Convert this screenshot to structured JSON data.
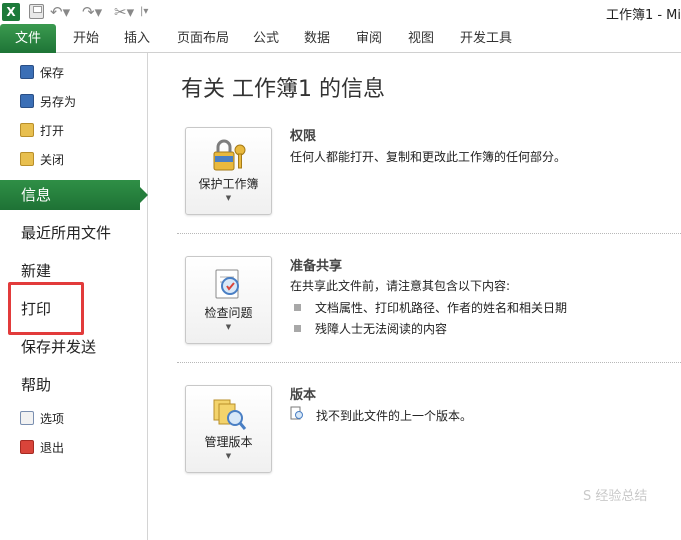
{
  "window": {
    "title": "工作簿1 - Mi"
  },
  "ribbon": {
    "tabs": [
      "文件",
      "开始",
      "插入",
      "页面布局",
      "公式",
      "数据",
      "审阅",
      "视图",
      "开发工具"
    ]
  },
  "nav": {
    "small_top": [
      {
        "label": "保存",
        "icon": "save-icon"
      },
      {
        "label": "另存为",
        "icon": "save-as-icon"
      },
      {
        "label": "打开",
        "icon": "open-folder-icon"
      },
      {
        "label": "关闭",
        "icon": "close-folder-icon"
      }
    ],
    "big": [
      {
        "label": "信息",
        "selected": true
      },
      {
        "label": "最近所用文件"
      },
      {
        "label": "新建"
      },
      {
        "label": "打印",
        "highlighted": true
      },
      {
        "label": "保存并发送"
      },
      {
        "label": "帮助"
      }
    ],
    "small_bottom": [
      {
        "label": "选项",
        "icon": "options-icon"
      },
      {
        "label": "退出",
        "icon": "exit-icon"
      }
    ]
  },
  "main": {
    "title": "有关 工作簿1 的信息",
    "sections": [
      {
        "button_label": "保护工作簿",
        "button_icon": "lock-keys-icon",
        "heading": "权限",
        "text": "任何人都能打开、复制和更改此工作簿的任何部分。"
      },
      {
        "button_label": "检查问题",
        "button_icon": "inspect-document-icon",
        "heading": "准备共享",
        "text": "在共享此文件前，请注意其包含以下内容:",
        "bullets": [
          "文档属性、打印机路径、作者的姓名和相关日期",
          "残障人士无法阅读的内容"
        ]
      },
      {
        "button_label": "管理版本",
        "button_icon": "manage-versions-icon",
        "heading": "版本",
        "text": "找不到此文件的上一个版本。"
      }
    ]
  },
  "caret": "▼",
  "watermark": "S 经验总结"
}
